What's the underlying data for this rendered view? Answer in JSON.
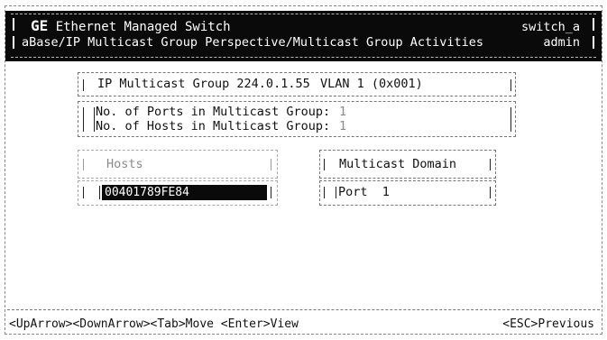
{
  "header": {
    "brand": "GE",
    "title": "Ethernet Managed Switch",
    "breadcrumb": "aBase/IP Multicast Group Perspective/Multicast Group Activities",
    "device": "switch_a",
    "user": "admin"
  },
  "group_info": {
    "group_label": "IP Multicast Group 224.0.1.55",
    "vlan_label": "VLAN 1 (0x001)"
  },
  "counts": {
    "ports_label": "No. of Ports in Multicast Group:",
    "ports_value": "1",
    "hosts_label": "No. of Hosts in Multicast Group:",
    "hosts_value": "1"
  },
  "hosts_panel": {
    "header": "Hosts",
    "items": [
      "00401789FE84"
    ]
  },
  "domain_panel": {
    "header": "Multicast Domain",
    "items": [
      "Port  1"
    ]
  },
  "footer": {
    "keys": "<UpArrow><DownArrow><Tab>Move <Enter>View",
    "escape": "<ESC>Previous"
  },
  "colors": {
    "header_bg": "#0a0a0a",
    "text": "#111111",
    "muted": "#8a8a8a"
  }
}
